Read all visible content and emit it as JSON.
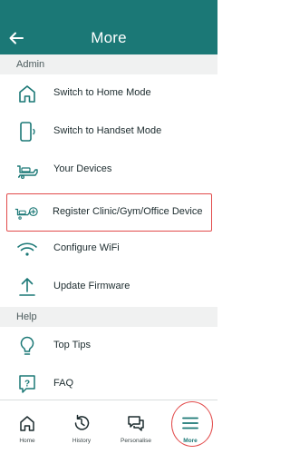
{
  "header": {
    "title": "More",
    "back_icon": "arrow-left-icon"
  },
  "colors": {
    "brand": "#1b7876",
    "highlight": "#e24b4b",
    "section_bg": "#f0f1f1"
  },
  "sections": {
    "admin": "Admin",
    "help": "Help"
  },
  "admin_items": [
    {
      "label": "Switch to Home Mode",
      "icon": "home-icon"
    },
    {
      "label": "Switch to Handset Mode",
      "icon": "phone-icon"
    },
    {
      "label": "Your Devices",
      "icon": "device-icon"
    },
    {
      "label": "Register Clinic/Gym/Office Device",
      "icon": "device-add-icon"
    },
    {
      "label": "Configure WiFi",
      "icon": "wifi-icon"
    },
    {
      "label": "Update Firmware",
      "icon": "upload-icon"
    }
  ],
  "help_items": [
    {
      "label": "Top Tips",
      "icon": "lightbulb-icon"
    },
    {
      "label": "FAQ",
      "icon": "faq-icon"
    }
  ],
  "bottom_nav": [
    {
      "label": "Home",
      "icon": "home-icon"
    },
    {
      "label": "History",
      "icon": "history-icon"
    },
    {
      "label": "Personalise",
      "icon": "chat-icon"
    },
    {
      "label": "More",
      "icon": "menu-icon",
      "active": true
    }
  ]
}
